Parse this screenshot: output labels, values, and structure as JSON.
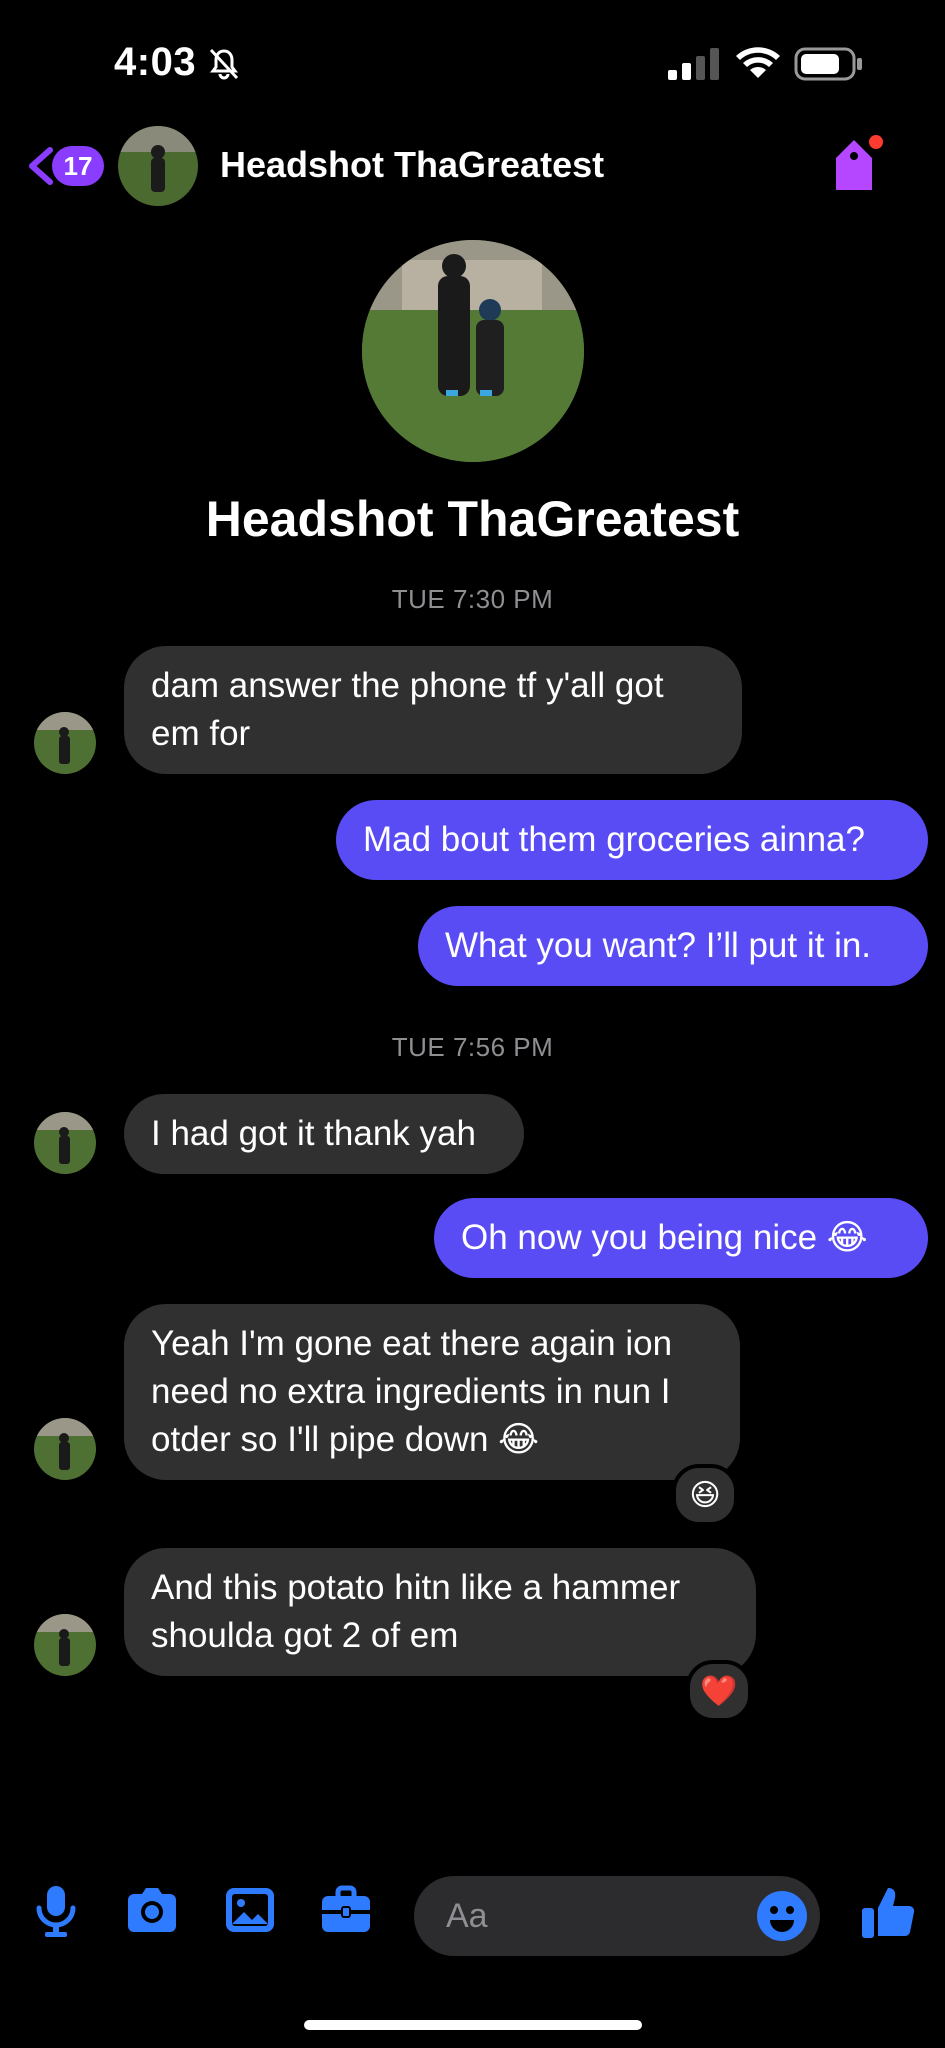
{
  "status_bar": {
    "time": "4:03"
  },
  "header": {
    "unread_count": "17",
    "contact_name": "Headshot ThaGreatest"
  },
  "profile": {
    "name": "Headshot ThaGreatest"
  },
  "timestamps": [
    "TUE 7:30 PM",
    "TUE 7:56 PM"
  ],
  "messages": [
    {
      "from": "them",
      "text": "dam answer the phone tf y'all got em for"
    },
    {
      "from": "me",
      "text": "Mad bout them groceries ainna?"
    },
    {
      "from": "me",
      "text": "What you want? I’ll put it in."
    },
    {
      "from": "them",
      "text": "I had got it thank yah"
    },
    {
      "from": "me",
      "text": "Oh now you being nice 😂"
    },
    {
      "from": "them",
      "text": "Yeah I'm gone eat there again ion need no extra ingredients in nun I otder so I'll pipe down 😂",
      "reaction": "😆"
    },
    {
      "from": "them",
      "text": "And this potato hitn like a hammer shoulda got 2 of em",
      "reaction": "❤️"
    }
  ],
  "composer": {
    "placeholder": "Aa"
  },
  "colors": {
    "accent": "#8b3dff",
    "outgoing_bubble": "#5a4cf5",
    "incoming_bubble": "#303030",
    "toolbar_blue": "#2f7bff"
  },
  "icons": [
    "bell-slash-icon",
    "signal-icon",
    "wifi-icon",
    "battery-icon",
    "back-chevron-icon",
    "tag-icon",
    "microphone-icon",
    "camera-icon",
    "image-icon",
    "briefcase-icon",
    "smiley-icon",
    "thumbs-up-icon"
  ]
}
